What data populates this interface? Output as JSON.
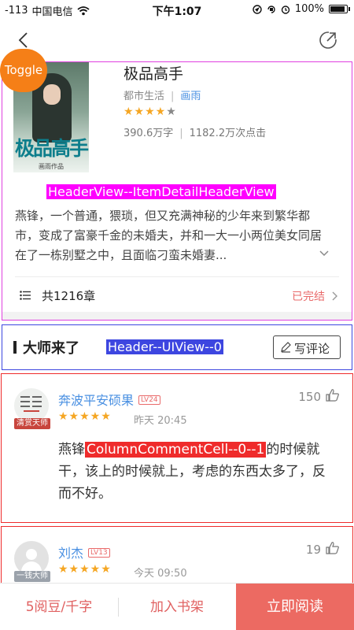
{
  "status_bar": {
    "signal": "-113",
    "carrier": "中国电信",
    "time": "下午1:07",
    "battery": "100%"
  },
  "toggle": {
    "label": "Toggle"
  },
  "book": {
    "title": "极品高手",
    "category": "都市生活",
    "author": "画雨",
    "rating_stars": 4,
    "rating_max": 5,
    "word_count": "390.6万字",
    "clicks": "1182.2万次点击",
    "cover_title": "极品高手",
    "cover_sub": "画雨作品",
    "intro": "燕锋，一个普通，猥琐，但又充满神秘的少年来到繁华都市，变成了富豪千金的未婚夫，并和一大一小两位美女同居在了一栋别墅之中，且面临刁蛮未婚妻..."
  },
  "chapters": {
    "count": "共1216章",
    "status": "已完结"
  },
  "debug": {
    "header_view": "HeaderView--ItemDetailHeaderView",
    "section_header": "Header--UIView--0",
    "comment_cell": "ColumnCommentCell--0--1"
  },
  "section": {
    "title": "大师来了",
    "write_button": "写评论"
  },
  "comments": [
    {
      "user": "奔波平安硕果",
      "level": "LV24",
      "badge": "清赏天师",
      "stars": 5,
      "time": "昨天 20:45",
      "likes": "150",
      "text_start": "燕锋",
      "text_end": "的时候就干，该上的时候就上，考虑的东西太多了，反而不好。"
    },
    {
      "user": "刘杰",
      "level": "LV13",
      "badge": "一钱大师",
      "stars": 5,
      "time": "今天 09:50",
      "likes": "19"
    }
  ],
  "bottom_bar": {
    "price": "5阅豆/千字",
    "add_shelf": "加入书架",
    "read_now": "立即阅读"
  },
  "colors": {
    "accent_red": "#ec6a62",
    "link_blue": "#4a90e2",
    "star": "#f5a623",
    "toggle_orange": "#f57f17"
  }
}
